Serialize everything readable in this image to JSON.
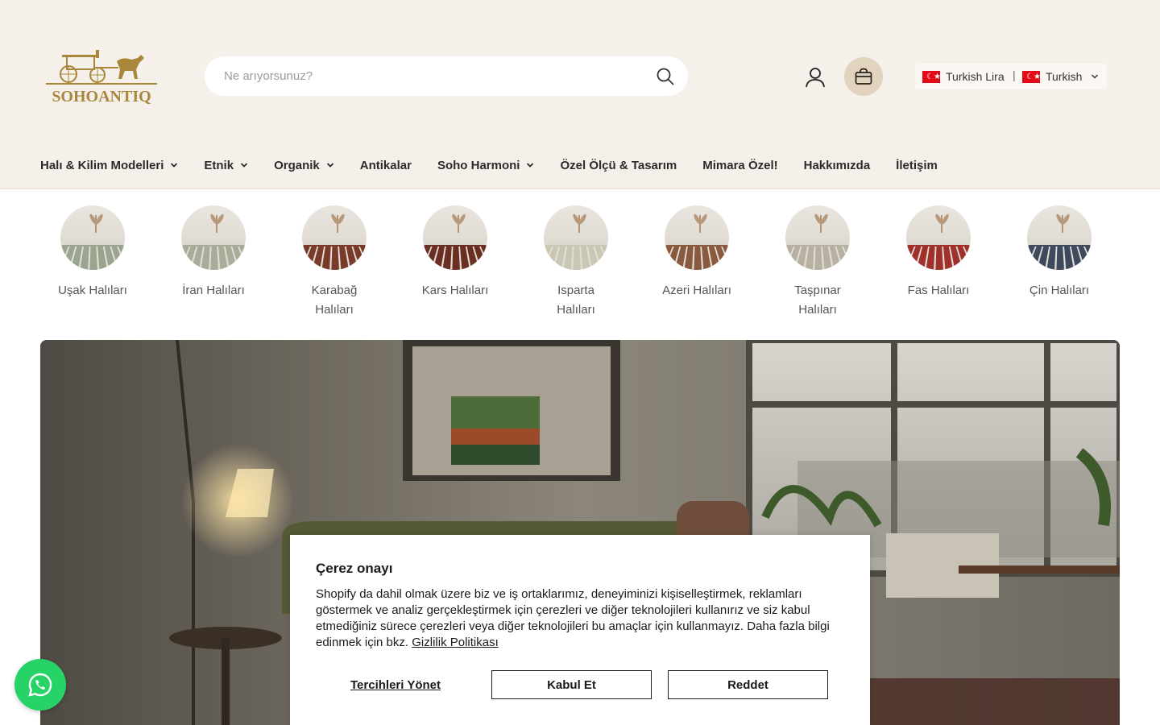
{
  "header": {
    "logo_text": "SOHOANTIQ",
    "search": {
      "placeholder": "Ne arıyorsunuz?"
    },
    "locale": {
      "currency": "Turkish Lira",
      "separator": "|",
      "language": "Turkish"
    }
  },
  "nav": {
    "items": [
      {
        "label": "Halı & Kilim Modelleri",
        "dropdown": true
      },
      {
        "label": "Etnik",
        "dropdown": true
      },
      {
        "label": "Organik",
        "dropdown": true
      },
      {
        "label": "Antikalar",
        "dropdown": false
      },
      {
        "label": "Soho Harmoni",
        "dropdown": true
      },
      {
        "label": "Özel Ölçü & Tasarım",
        "dropdown": false
      },
      {
        "label": "Mimara Özel!",
        "dropdown": false
      },
      {
        "label": "Hakkımızda",
        "dropdown": false
      },
      {
        "label": "İletişim",
        "dropdown": false
      }
    ]
  },
  "categories": [
    {
      "label": "Uşak Halıları",
      "rug_color": "#9aa58f"
    },
    {
      "label": "İran Halıları",
      "rug_color": "#a8ad9a"
    },
    {
      "label": "Karabağ Halıları",
      "rug_color": "#7a3a2a"
    },
    {
      "label": "Kars Halıları",
      "rug_color": "#6b2e22"
    },
    {
      "label": "Isparta Halıları",
      "rug_color": "#c9c6b4"
    },
    {
      "label": "Azeri Halıları",
      "rug_color": "#8a5a3f"
    },
    {
      "label": "Taşpınar Halıları",
      "rug_color": "#b7b1a1"
    },
    {
      "label": "Fas Halıları",
      "rug_color": "#a0302a"
    },
    {
      "label": "Çin Halıları",
      "rug_color": "#3e4a5c"
    }
  ],
  "cookie": {
    "title": "Çerez onayı",
    "body": "Shopify da dahil olmak üzere biz ve iş ortaklarımız, deneyiminizi kişiselleştirmek, reklamları göstermek ve analiz gerçekleştirmek için çerezleri ve diğer teknolojileri kullanırız ve siz kabul etmediğiniz sürece çerezleri veya diğer teknolojileri bu amaçlar için kullanmayız. Daha fazla bilgi edinmek için bkz.",
    "link": "Gizlilik Politikası",
    "manage_label": "Tercihleri Yönet",
    "accept_label": "Kabul Et",
    "reject_label": "Reddet"
  },
  "colors": {
    "header_bg": "#f5f0ea",
    "brand_gold": "#a8873a",
    "cart_bg": "#e2d3bf",
    "whatsapp": "#25d366",
    "flag_red": "#e30a17"
  }
}
